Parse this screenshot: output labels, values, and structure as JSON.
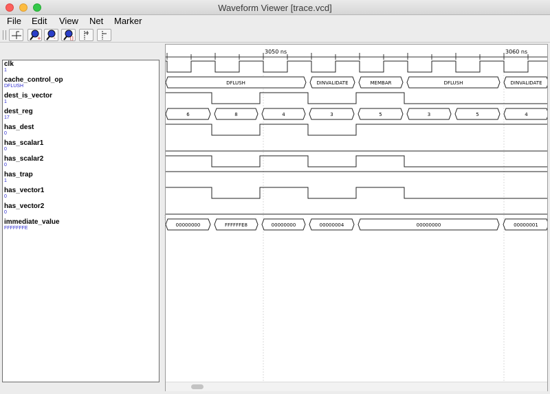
{
  "window": {
    "title": "Waveform Viewer [trace.vcd]"
  },
  "menu": [
    "File",
    "Edit",
    "View",
    "Net",
    "Marker"
  ],
  "toolbar": [
    {
      "name": "insert-marker-icon"
    },
    {
      "name": "zoom-in-icon"
    },
    {
      "name": "zoom-out-icon"
    },
    {
      "name": "zoom-fit-icon"
    },
    {
      "name": "go-next-marker-icon"
    },
    {
      "name": "go-prev-marker-icon"
    }
  ],
  "timeline": {
    "labels": [
      "3050 ns",
      "3060 ns"
    ]
  },
  "signals": [
    {
      "name": "clk",
      "value": "1"
    },
    {
      "name": "cache_control_op",
      "value": "DFLUSH"
    },
    {
      "name": "dest_is_vector",
      "value": "1"
    },
    {
      "name": "dest_reg",
      "value": "17"
    },
    {
      "name": "has_dest",
      "value": "0"
    },
    {
      "name": "has_scalar1",
      "value": "0"
    },
    {
      "name": "has_scalar2",
      "value": "0"
    },
    {
      "name": "has_trap",
      "value": "1"
    },
    {
      "name": "has_vector1",
      "value": "0"
    },
    {
      "name": "has_vector2",
      "value": "0"
    },
    {
      "name": "immediate_value",
      "value": "FFFFFFFE"
    }
  ],
  "waves": [
    {
      "signal": "clk",
      "kind": "clock"
    },
    {
      "signal": "cache_control_op",
      "kind": "bus",
      "segments": [
        "DFLUSH",
        "DINVALIDATE",
        "MEMBAR",
        "DFLUSH",
        "DINVALIDATE"
      ]
    },
    {
      "signal": "dest_is_vector",
      "kind": "bit",
      "levels": [
        1,
        0,
        1,
        0,
        1,
        0
      ]
    },
    {
      "signal": "dest_reg",
      "kind": "bus",
      "segments": [
        "6",
        "8",
        "4",
        "3",
        "5",
        "3",
        "5",
        "4"
      ]
    },
    {
      "signal": "has_dest",
      "kind": "bit",
      "levels": [
        1,
        0,
        1,
        0,
        1
      ]
    },
    {
      "signal": "has_scalar1",
      "kind": "bit",
      "levels": [
        0
      ]
    },
    {
      "signal": "has_scalar2",
      "kind": "bit",
      "levels": [
        1,
        0,
        1,
        0,
        1,
        0
      ]
    },
    {
      "signal": "has_trap",
      "kind": "bit",
      "levels": [
        1
      ]
    },
    {
      "signal": "has_vector1",
      "kind": "bit",
      "levels": [
        1,
        0,
        1,
        0,
        1,
        0
      ]
    },
    {
      "signal": "has_vector2",
      "kind": "bit",
      "levels": [
        0
      ]
    },
    {
      "signal": "immediate_value",
      "kind": "bus",
      "segments": [
        "00000000",
        "FFFFFFE8",
        "00000000",
        "00000004",
        "00000000",
        "00000001"
      ]
    }
  ]
}
